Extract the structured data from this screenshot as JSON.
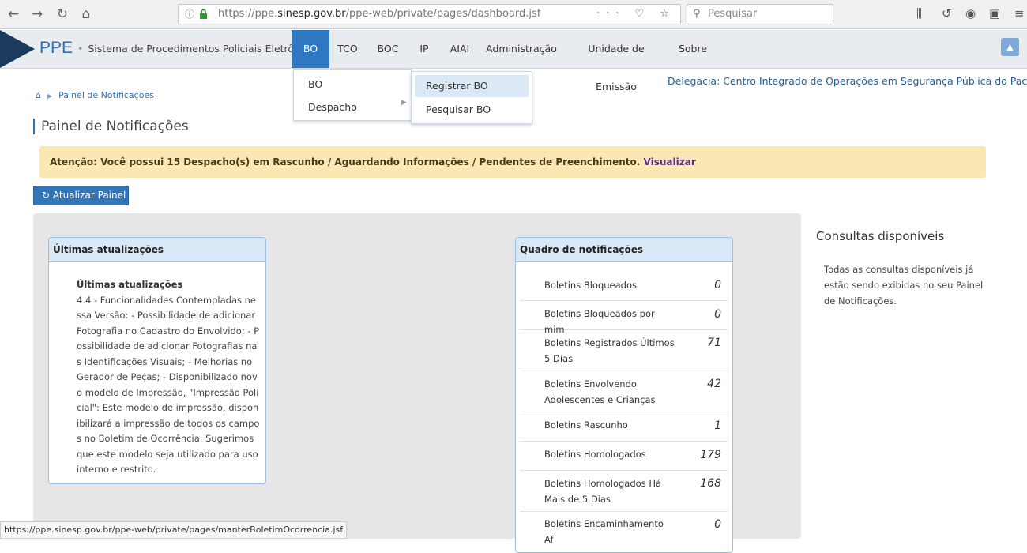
{
  "browser": {
    "url_prefix": "https://ppe.",
    "url_domain": "sinesp.gov.br",
    "url_path": "/ppe-web/private/pages/dashboard.jsf",
    "url_icons": "··· ♡ ☆",
    "search_placeholder": "Pesquisar"
  },
  "header": {
    "logo": "PPE",
    "subtitle": "Sistema de Procedimentos Policiais Eletrônicos",
    "menu": [
      "BO",
      "TCO",
      "BOC",
      "IP",
      "AIAI",
      "Administração",
      "Unidade de Emissão",
      "Sobre"
    ]
  },
  "dropdown": {
    "items": [
      "BO",
      "Despacho"
    ],
    "submenu": [
      "Registrar BO",
      "Pesquisar BO"
    ]
  },
  "delegacia": "Delegacia: Centro Integrado de Operações em Segurança Pública do Pacoval - AP",
  "breadcrumb": {
    "current": "Painel de Notificações"
  },
  "page_title": "Painel de Notificações",
  "alert": {
    "text": "Atenção: Você possui 15 Despacho(s) em Rascunho / Aguardando Informações / Pendentes de Preenchimento.",
    "link": "Visualizar"
  },
  "refresh_button": "Atualizar Painel",
  "updates_card": {
    "header": "Últimas atualizações",
    "title": "Últimas atualizações",
    "text": "4.4 - Funcionalidades Contempladas nessa Versão: - Possibilidade de adicionar Fotografia no Cadastro do Envolvido; - Possibilidade de adicionar Fotografias nas Identificações Visuais; - Melhorias no Gerador de Peças; - Disponibilizado novo modelo de Impressão, \"Impressão Policial\": Este modelo de impressão, disponibilizará a impressão de todos os campos no Boletim de Ocorrência. Sugerimos que este modelo seja utilizado para uso interno e restrito."
  },
  "notifications_card": {
    "header": "Quadro de notificações",
    "rows": [
      {
        "label": "Boletins Bloqueados",
        "count": "0"
      },
      {
        "label": "Boletins Bloqueados por mim",
        "count": "0"
      },
      {
        "label": "Boletins Registrados Últimos 5 Dias",
        "count": "71"
      },
      {
        "label": "Boletins Envolvendo Adolescentes e Crianças",
        "count": "42"
      },
      {
        "label": "Boletins Rascunho",
        "count": "1"
      },
      {
        "label": "Boletins Homologados",
        "count": "179"
      },
      {
        "label": "Boletins Homologados Há Mais de 5 Dias",
        "count": "168"
      },
      {
        "label": "Boletins Encaminhamento Af",
        "count": "0"
      }
    ]
  },
  "side": {
    "title": "Consultas disponíveis",
    "text": "Todas as consultas disponíveis já estão sendo exibidas no seu Painel de Notificações."
  },
  "status_bar": "https://ppe.sinesp.gov.br/ppe-web/private/pages/manterBoletimOcorrencia.jsf"
}
